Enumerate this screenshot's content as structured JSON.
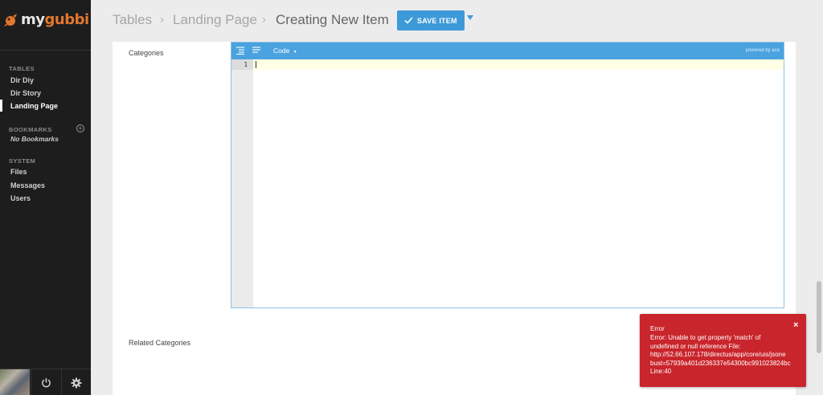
{
  "app": {
    "logo_my": "my",
    "logo_gubbi": "gubbi"
  },
  "sidebar": {
    "tables_header": "TABLES",
    "tables": [
      {
        "label": "Dir Diy"
      },
      {
        "label": "Dir Story"
      },
      {
        "label": "Landing Page",
        "active": true
      }
    ],
    "bookmarks_header": "BOOKMARKS",
    "no_bookmarks": "No Bookmarks",
    "system_header": "SYSTEM",
    "system": [
      {
        "label": "Files"
      },
      {
        "label": "Messages"
      },
      {
        "label": "Users"
      }
    ],
    "footer_icons": [
      "user-avatar",
      "power-icon",
      "gear-icon"
    ]
  },
  "header": {
    "breadcrumbs": [
      "Tables",
      "Landing Page"
    ],
    "current": "Creating New Item",
    "save_label": "SAVE ITEM"
  },
  "form": {
    "fields": [
      {
        "label": "Categories"
      },
      {
        "label": "Related Categories"
      }
    ],
    "editor": {
      "mode": "Code",
      "mode_caret": "▾",
      "powered_by": "powered by ace",
      "line_numbers": [
        "1"
      ],
      "content": ""
    }
  },
  "toast": {
    "title": "Error",
    "message": "Error: Unable to get property 'match' of\nundefined or null reference File:\nhttp://52.66.107.178/directus/app/core/uis/jsone\nbust=57939a401d236337e54300bc991023824bc\nLine:40",
    "close": "×"
  },
  "colors": {
    "sidebar_bg": "#1d1d1d",
    "accent": "#3d9ad8",
    "editor_toolbar": "#4aa3df",
    "error": "#c9252c",
    "logo_orange": "#e2762e"
  }
}
